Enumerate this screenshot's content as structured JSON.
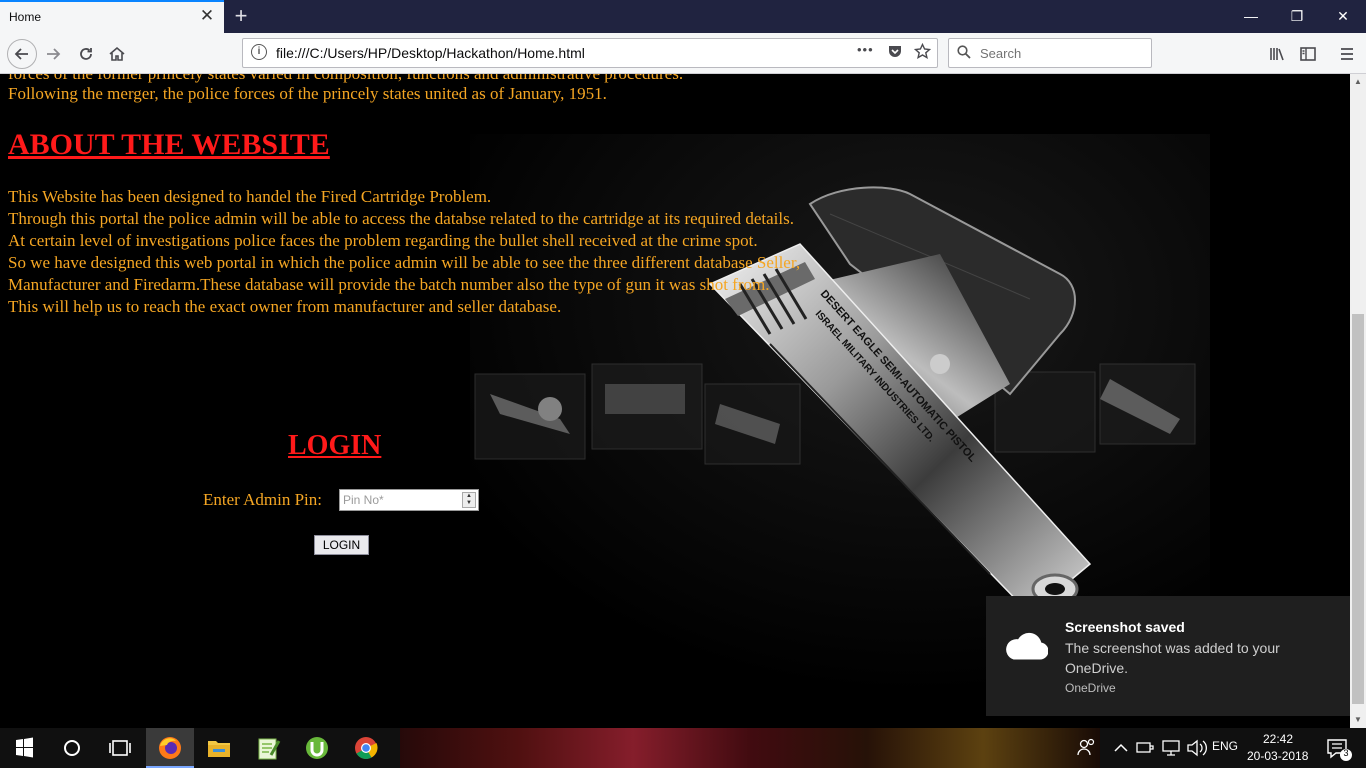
{
  "browser": {
    "tab_title": "Home",
    "tab_close": "✕",
    "new_tab": "+",
    "window_controls": {
      "minimize": "—",
      "restore": "❐",
      "close": "✕"
    },
    "url": "file:///C:/Users/HP/Desktop/Hackathon/Home.html",
    "url_more": "•••",
    "search_placeholder": "Search",
    "icons": [
      "back-icon",
      "forward-icon",
      "reload-icon",
      "home-icon",
      "page-info-icon",
      "pocket-icon",
      "bookmark-star-icon",
      "library-icon",
      "sidebar-icon",
      "menu-icon"
    ]
  },
  "page": {
    "history_lines": [
      "forces of the former princely states varied in composition, functions and administrative procedures.",
      "Following the merger, the police forces of the princely states united as of January, 1951."
    ],
    "about_heading": "ABOUT THE WEBSITE",
    "about_lines": [
      "This Website has been designed to handel the Fired Cartridge Problem.",
      "Through this portal the police admin will be able to access the databse related to the cartridge at its required details.",
      "At certain level of investigations police faces the problem regarding the bullet shell received at the crime spot.",
      "So we have designed this web portal in which the police admin will be able to see the three different database Seller,",
      "Manufacturer and Firedarm.These database will provide the batch number also the type of gun it was shot from.",
      "This will help us to reach the exact owner from manufacturer and seller database."
    ],
    "login_heading": "LOGIN",
    "pin_label": "Enter Admin Pin:",
    "pin_placeholder": "Pin No*",
    "login_button": "LOGIN",
    "gun_engraving_1": "DESERT EAGLE SEMI-AUTOMATIC PISTOL",
    "gun_engraving_2": "ISRAEL MILITARY INDUSTRIES LTD."
  },
  "toast": {
    "title": "Screenshot saved",
    "body": "The screenshot was added to your OneDrive.",
    "source": "OneDrive"
  },
  "taskbar": {
    "apps": [
      "windows-start-icon",
      "cortana-icon",
      "task-view-icon",
      "firefox-icon",
      "file-explorer-icon",
      "notepad-plus-icon",
      "utorrent-icon",
      "chrome-icon"
    ],
    "language": "ENG",
    "time": "22:42",
    "date": "20-03-2018",
    "notification_count": "3"
  },
  "colors": {
    "page_text": "#f5a623",
    "heading": "#ff1a1a",
    "tabbar": "#202340"
  }
}
